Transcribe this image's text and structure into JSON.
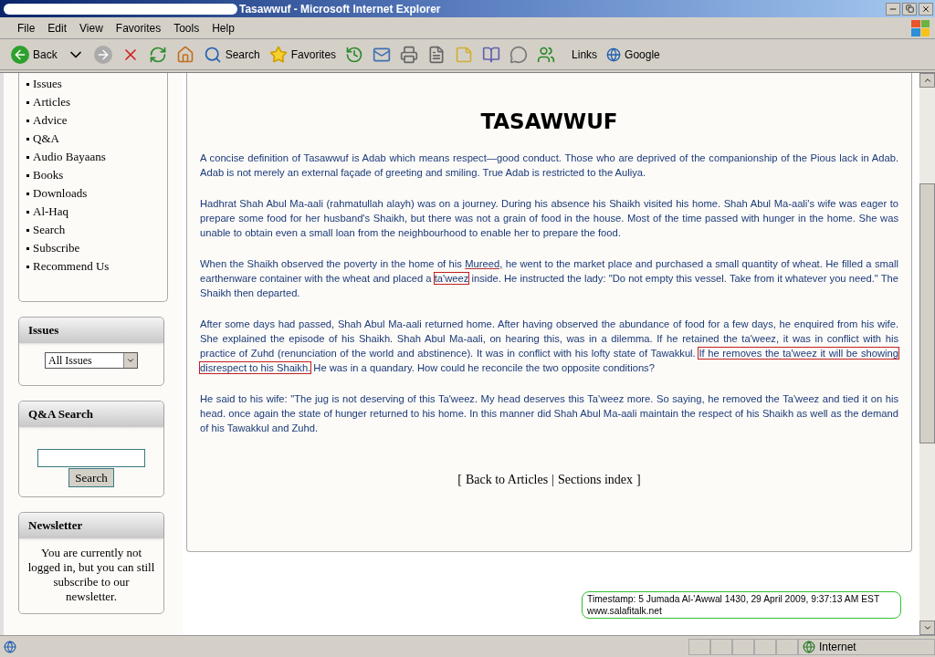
{
  "window": {
    "title": "Tasawwuf - Microsoft Internet Explorer"
  },
  "menu": [
    "File",
    "Edit",
    "View",
    "Favorites",
    "Tools",
    "Help"
  ],
  "toolbar": {
    "back": "Back",
    "search": "Search",
    "favorites": "Favorites",
    "links": "Links",
    "google": "Google"
  },
  "sidebar": {
    "nav": [
      "Issues",
      "Articles",
      "Advice",
      "Q&A",
      "Audio Bayaans",
      "Books",
      "Downloads",
      "Al-Haq",
      "Search",
      "Subscribe",
      "Recommend Us"
    ],
    "issues": {
      "title": "Issues",
      "value": "All Issues"
    },
    "qa_search": {
      "title": "Q&A Search",
      "button": "Search"
    },
    "newsletter": {
      "title": "Newsletter",
      "text": "You are currently not logged in, but you can still subscribe to our newsletter."
    }
  },
  "article": {
    "heading": "TASAWWUF",
    "paragraphs": [
      [
        {
          "kind": "plain",
          "text": "A concise definition of Tasawwuf is Adab which means respect—good conduct. Those who are deprived of the companionship of the Pious lack in Adab. Adab is not merely an external façade of greeting and smiling. True Adab is restricted to the Auliya."
        }
      ],
      [
        {
          "kind": "plain",
          "text": "Hadhrat Shah Abul Ma-aali (rahmatullah alayh) was on a journey. During his absence his Shaikh visited his home. Shah Abul Ma-aali's wife was eager to prepare some food for her husband's Shaikh, but there was not a grain of food in the house. Most of the time passed with hunger in the home. She was unable to obtain even a small loan from the neighbourhood to enable her to prepare the food."
        }
      ],
      [
        {
          "kind": "plain",
          "text": "When the Shaikh observed the poverty in the home of his "
        },
        {
          "kind": "underline",
          "text": "Mureed,"
        },
        {
          "kind": "plain",
          "text": " he went to the market place and purchased a small quantity of wheat. He filled a small earthenware container with the wheat and placed a "
        },
        {
          "kind": "boxed",
          "text": "ta'weez"
        },
        {
          "kind": "plain",
          "text": " inside. He instructed the lady: \"Do not empty this vessel. Take from it whatever you need.\" The Shaikh then departed."
        }
      ],
      [
        {
          "kind": "plain",
          "text": "After some days had passed, Shah Abul Ma-aali returned home. After having observed the abundance of food for a few days, he enquired from his wife. She explained the episode of his Shaikh. Shah Abul Ma-aali, on hearing this, was in a dilemma. If he retained the ta'weez, it was in conflict with his practice of Zuhd (renunciation of the world and abstinence). It was in conflict with his lofty state of Tawakkul. "
        },
        {
          "kind": "boxed",
          "text": "If he removes the ta'weez it will be showing disrespect to his Shaikh."
        },
        {
          "kind": "plain",
          "text": " He was in a quandary. How could he reconcile the two opposite conditions?"
        }
      ],
      [
        {
          "kind": "plain",
          "text": "He said to his wife: \"The jug is not deserving of this Ta'weez. My head deserves this Ta'weez more. So saying, he removed the Ta'weez and tied it on his head. once again the state of hunger returned to his home. In this manner did Shah Abul Ma-aali maintain the respect of his Shaikh as well as the demand of his Tawakkul and Zuhd."
        }
      ]
    ],
    "footer": {
      "open": "[",
      "back": "Back to Articles",
      "sep": "|",
      "index": "Sections index",
      "close": "]"
    }
  },
  "timestamp": [
    "Timestamp: 5 Jumada Al-'Awwal 1430, 29 April 2009, 9:37:13 AM EST",
    "www.salafitalk.net"
  ],
  "status_bar": {
    "zone": "Internet"
  }
}
